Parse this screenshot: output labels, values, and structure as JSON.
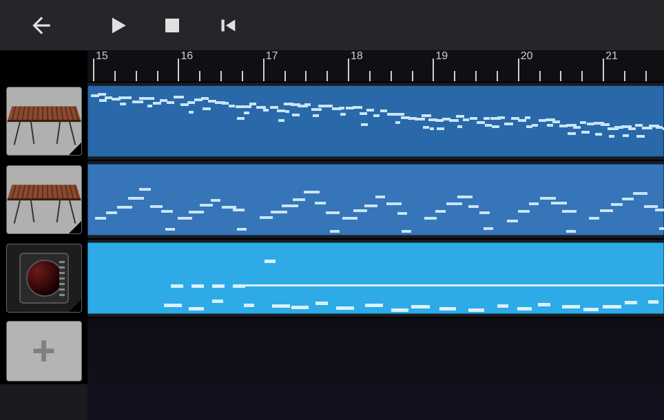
{
  "toolbar": {
    "back": "Back",
    "play": "Play",
    "stop": "Stop",
    "skip_start": "Skip to start"
  },
  "ruler": {
    "marks": [
      "15",
      "16",
      "17",
      "18",
      "19",
      "20",
      "21"
    ]
  },
  "tracks": [
    {
      "instrument": "marimba",
      "clip_color": "blue-dark"
    },
    {
      "instrument": "marimba",
      "clip_color": "blue-mid"
    },
    {
      "instrument": "drum-machine",
      "clip_color": "blue-light"
    }
  ],
  "add_track": {
    "label": "+"
  }
}
